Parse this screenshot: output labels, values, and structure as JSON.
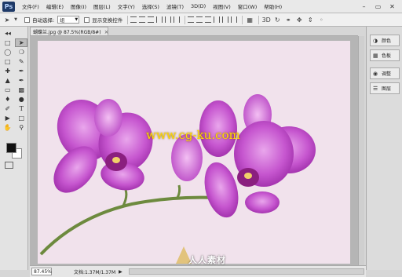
{
  "app": {
    "logo": "Ps",
    "logo_color": "#1f3a68"
  },
  "menu": [
    "文件(F)",
    "编辑(E)",
    "图像(I)",
    "图层(L)",
    "文字(Y)",
    "选择(S)",
    "滤镜(T)",
    "3D(D)",
    "视图(V)",
    "窗口(W)",
    "帮助(H)"
  ],
  "window_controls": {
    "minimize": "–",
    "restore": "▭",
    "close": "✕"
  },
  "options_bar": {
    "tool_icon": "move-arrow-icon",
    "auto_select_label": "自动选择:",
    "auto_select_value": "组",
    "show_transform_label": "显示变换控件"
  },
  "document": {
    "tab_title": "蝴蝶兰.jpg @ 87.5%(RGB/8#)",
    "close_glyph": "×"
  },
  "toolbox": {
    "foreground_color": "#111111",
    "background_color": "#ffffff"
  },
  "panels": [
    {
      "icon": "color-swatch-icon",
      "label": "颜色"
    },
    {
      "icon": "swatches-grid-icon",
      "label": "色板"
    },
    {
      "icon": "adjustments-icon",
      "label": "调整"
    },
    {
      "icon": "layers-icon",
      "label": "图层"
    }
  ],
  "status": {
    "zoom": "87.45%",
    "doc_info": "文档:1.37M/1.37M",
    "arrow": "▶"
  },
  "image": {
    "background_color": "#f1e2ec",
    "watermark_url": "www.cg-ku.com",
    "watermark_url_color": "#ffd800",
    "brand": "人人素材"
  }
}
